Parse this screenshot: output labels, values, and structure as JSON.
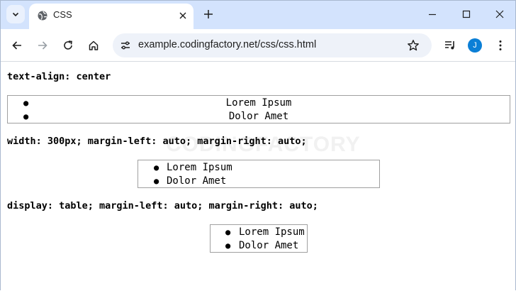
{
  "tab": {
    "title": "CSS"
  },
  "toolbar": {
    "url": "example.codingfactory.net/css/css.html",
    "avatar_letter": "J"
  },
  "watermark": "CODINGFACTORY",
  "sections": [
    {
      "heading": "text-align: center",
      "items": [
        "Lorem Ipsum",
        "Dolor Amet"
      ]
    },
    {
      "heading": "width: 300px; margin-left: auto; margin-right: auto;",
      "items": [
        "Lorem Ipsum",
        "Dolor Amet"
      ]
    },
    {
      "heading": "display: table; margin-left: auto; margin-right: auto;",
      "items": [
        "Lorem Ipsum",
        "Dolor Amet"
      ]
    }
  ],
  "colors": {
    "tabstrip": "#d3e3fd",
    "accent": "#0b7fd6",
    "omnibox": "#eef2f9"
  }
}
